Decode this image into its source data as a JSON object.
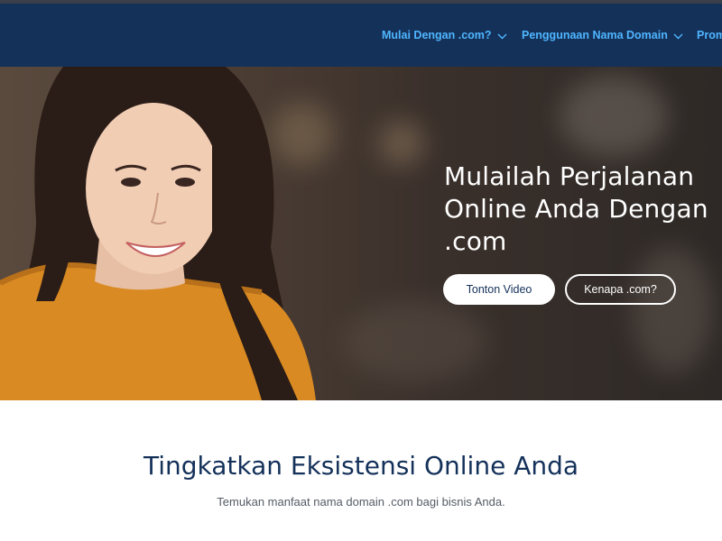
{
  "nav": {
    "items": [
      {
        "label": "Mulai Dengan .com?",
        "icon": "chevron-down-icon"
      },
      {
        "label": "Penggunaan Nama Domain",
        "icon": "chevron-down-icon"
      },
      {
        "label": "Prom",
        "icon": ""
      }
    ]
  },
  "hero": {
    "title": "Mulailah Perjalanan Online Anda Dengan .com",
    "primary_button": "Tonton Video",
    "secondary_button": "Kenapa .com?",
    "image": "woman-in-orange-sweater-photo"
  },
  "section": {
    "title": "Tingkatkan Eksistensi Online Anda",
    "subtitle": "Temukan manfaat nama domain .com bagi bisnis Anda."
  },
  "colors": {
    "nav_bg": "#14315a",
    "nav_link": "#4fb6ff",
    "heading": "#14315a"
  }
}
